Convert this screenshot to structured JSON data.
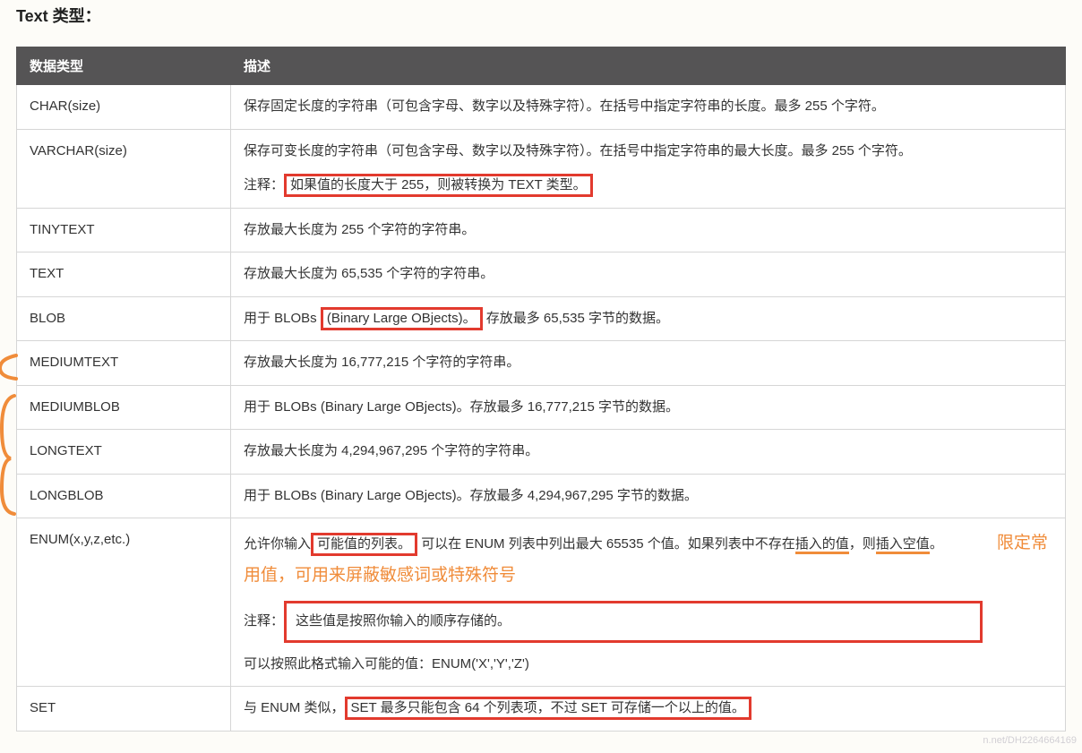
{
  "heading": "Text 类型：",
  "table": {
    "headers": {
      "type": "数据类型",
      "desc": "描述"
    },
    "rows": {
      "char": {
        "type": "CHAR(size)",
        "desc": "保存固定长度的字符串（可包含字母、数字以及特殊字符）。在括号中指定字符串的长度。最多 255 个字符。"
      },
      "varchar": {
        "type": "VARCHAR(size)",
        "desc_main": "保存可变长度的字符串（可包含字母、数字以及特殊字符）。在括号中指定字符串的最大长度。最多 255 个字符。",
        "note_prefix": "注释：",
        "note_boxed": "如果值的长度大于 255，则被转换为 TEXT 类型。"
      },
      "tinytext": {
        "type": "TINYTEXT",
        "desc": "存放最大长度为 255 个字符的字符串。"
      },
      "text": {
        "type": "TEXT",
        "desc": "存放最大长度为 65,535 个字符的字符串。"
      },
      "blob": {
        "type": "BLOB",
        "pre": "用于 BLOBs ",
        "boxed": "(Binary Large OBjects)。",
        "post": "存放最多 65,535 字节的数据。"
      },
      "mediumtext": {
        "type": "MEDIUMTEXT",
        "desc": "存放最大长度为 16,777,215 个字符的字符串。"
      },
      "mediumblob": {
        "type": "MEDIUMBLOB",
        "desc": "用于 BLOBs (Binary Large OBjects)。存放最多 16,777,215 字节的数据。"
      },
      "longtext": {
        "type": "LONGTEXT",
        "desc": "存放最大长度为 4,294,967,295 个字符的字符串。"
      },
      "longblob": {
        "type": "LONGBLOB",
        "desc": "用于 BLOBs (Binary Large OBjects)。存放最多 4,294,967,295 字节的数据。"
      },
      "enum": {
        "type": "ENUM(x,y,z,etc.)",
        "line1_pre": "允许你输入",
        "line1_box": "可能值的列表。",
        "line1_mid": "可以在 ENUM 列表中列出最大 65535 个值。如果列表中不存在",
        "line1_u1": "插入的值",
        "line1_mid2": "，则",
        "line1_u2": "插入空值",
        "line1_end": "。",
        "orange_annotation": "限定常用值，可用来屏蔽敏感词或特殊符号",
        "note_prefix": "注释：",
        "note_boxed": "这些值是按照你输入的顺序存储的。",
        "example": "可以按照此格式输入可能的值：ENUM('X','Y','Z')"
      },
      "set": {
        "type": "SET",
        "pre": "与 ENUM 类似，",
        "boxed": "SET 最多只能包含 64 个列表项，不过 SET 可存储一个以上的值。"
      }
    }
  },
  "watermark": "n.net/DH2264664169"
}
